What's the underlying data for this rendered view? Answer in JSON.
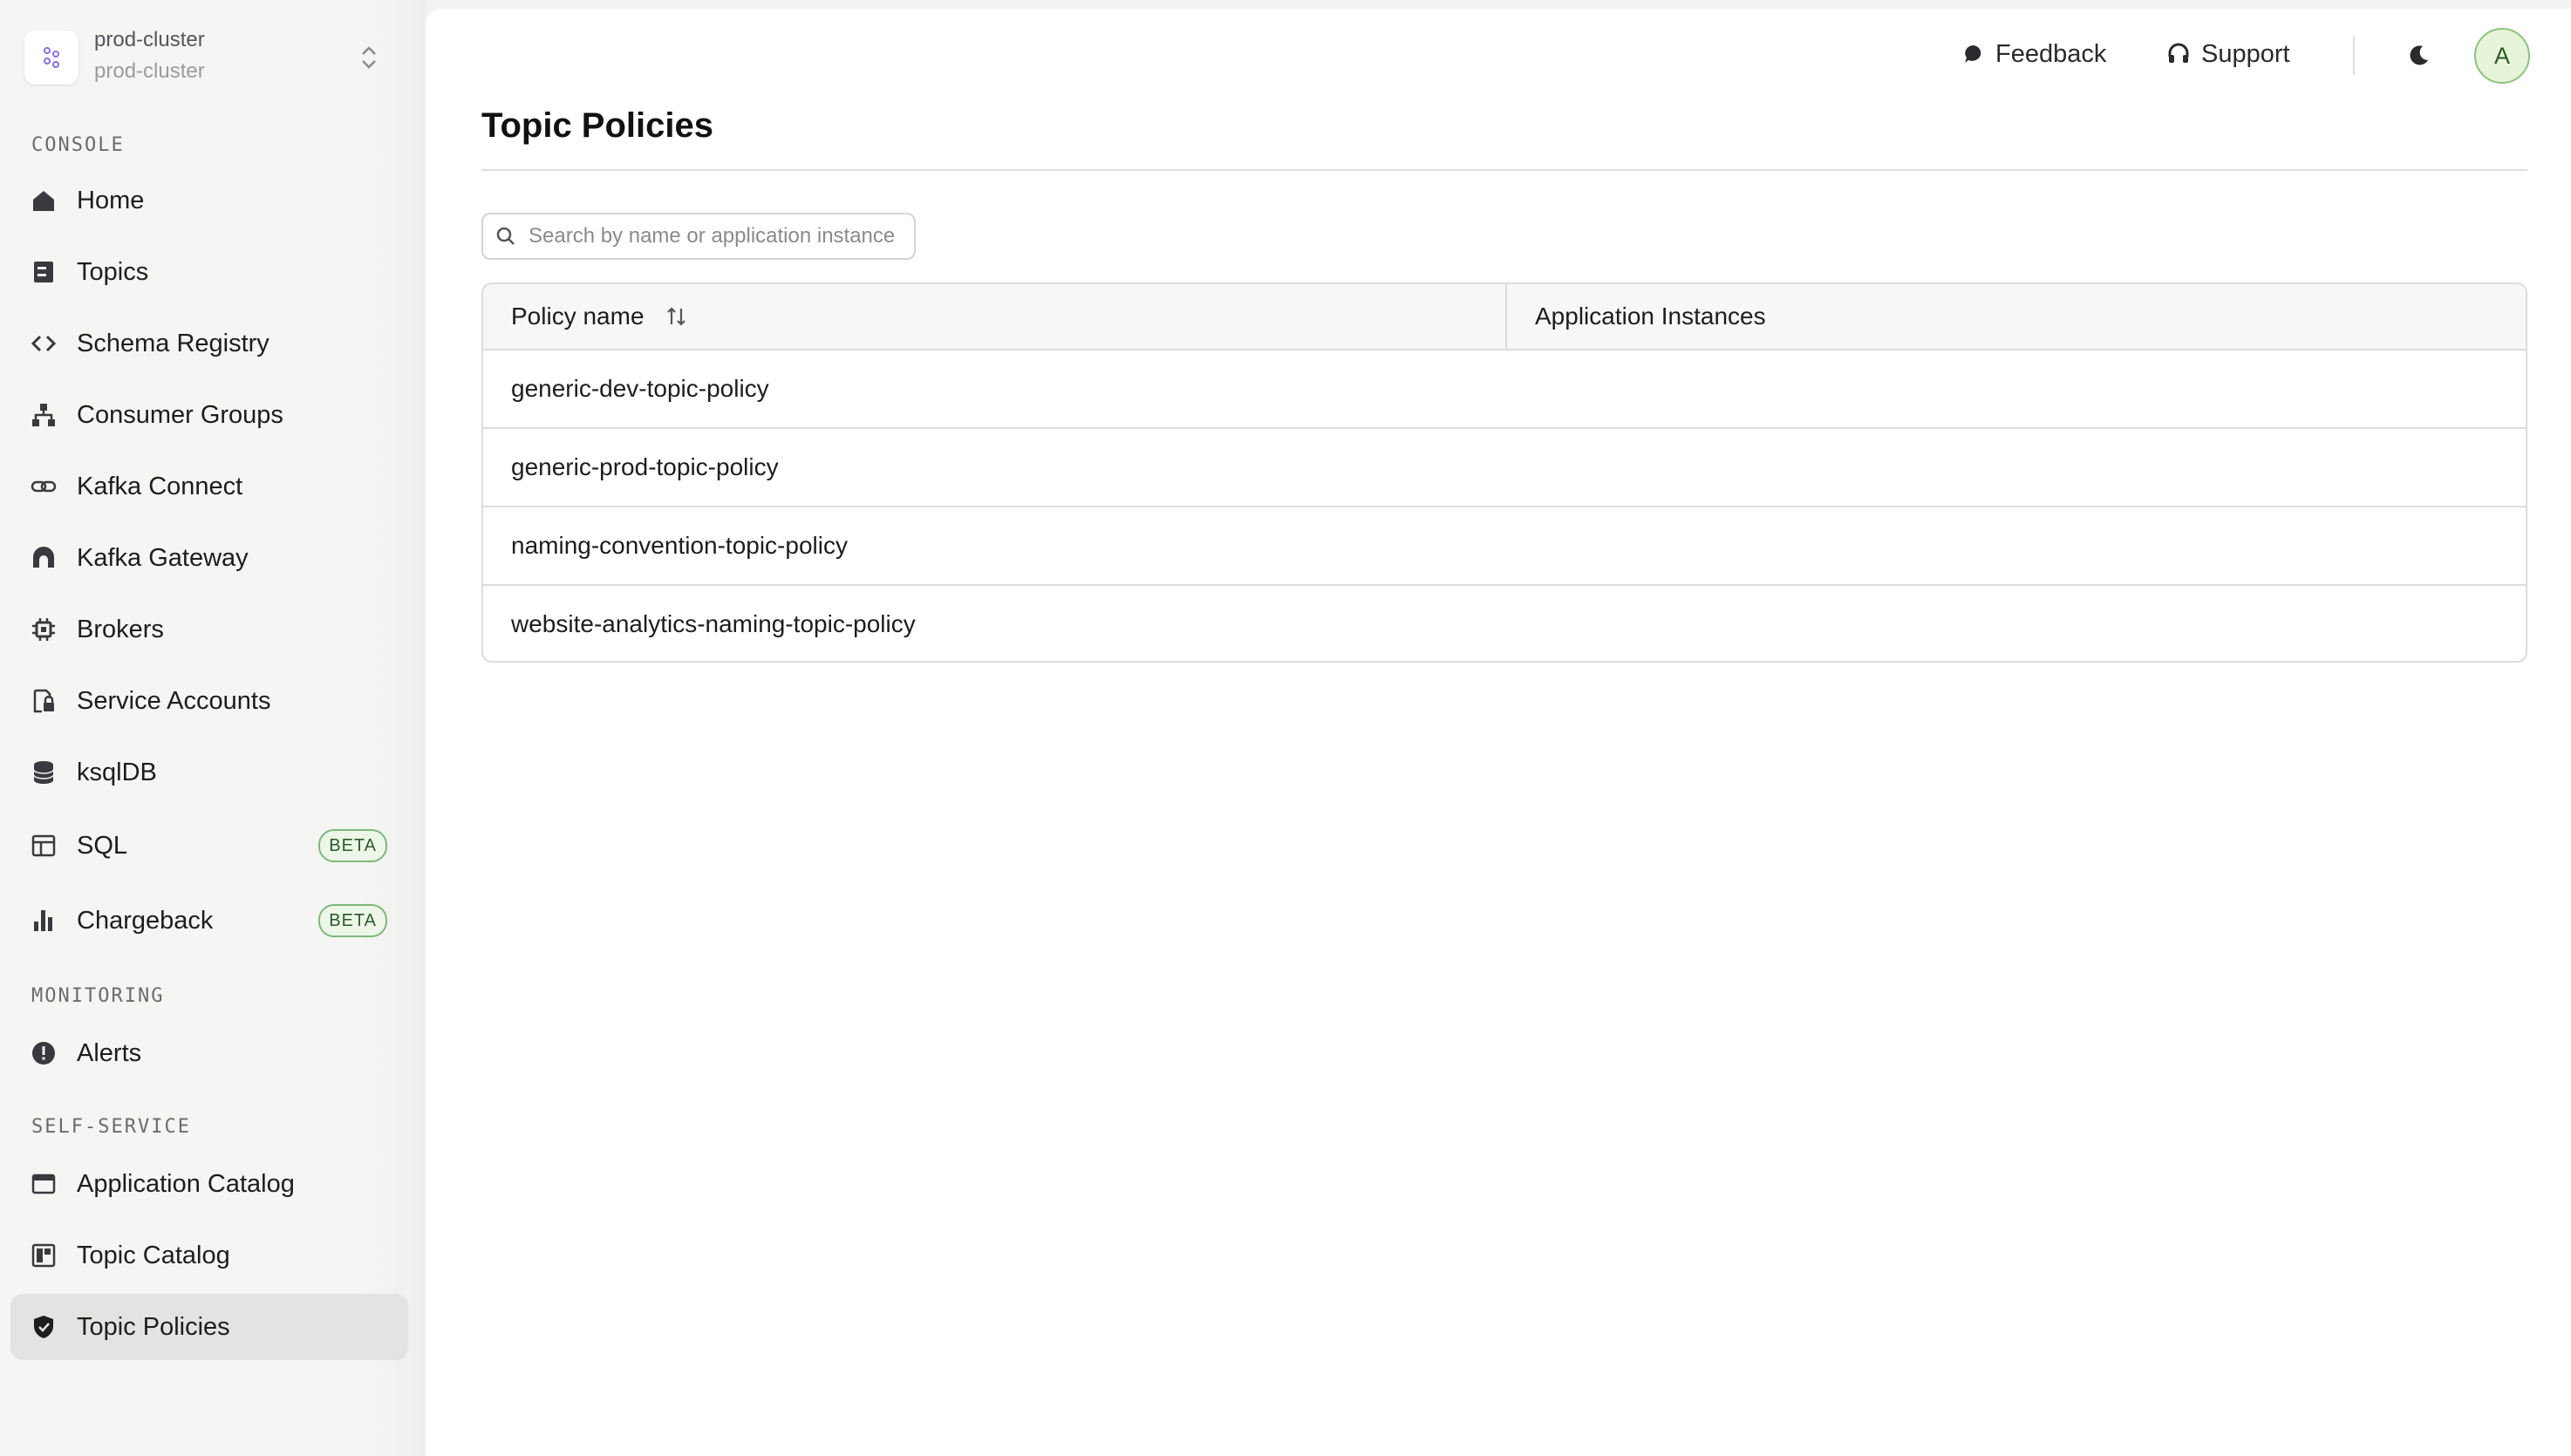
{
  "cluster": {
    "name": "prod-cluster",
    "subtitle": "prod-cluster"
  },
  "sidebar": {
    "sections": {
      "console": "CONSOLE",
      "monitoring": "MONITORING",
      "self_service": "SELF-SERVICE"
    },
    "items": [
      {
        "label": "Home",
        "icon": "home-icon"
      },
      {
        "label": "Topics",
        "icon": "topics-icon"
      },
      {
        "label": "Schema Registry",
        "icon": "code-icon"
      },
      {
        "label": "Consumer Groups",
        "icon": "hierarchy-icon"
      },
      {
        "label": "Kafka Connect",
        "icon": "link-icon"
      },
      {
        "label": "Kafka Gateway",
        "icon": "gateway-icon"
      },
      {
        "label": "Brokers",
        "icon": "chip-icon"
      },
      {
        "label": "Service Accounts",
        "icon": "lock-file-icon"
      },
      {
        "label": "ksqlDB",
        "icon": "database-icon"
      },
      {
        "label": "SQL",
        "icon": "table-icon",
        "badge": "BETA"
      },
      {
        "label": "Chargeback",
        "icon": "bar-chart-icon",
        "badge": "BETA"
      },
      {
        "label": "Alerts",
        "icon": "alert-icon"
      },
      {
        "label": "Application Catalog",
        "icon": "window-icon"
      },
      {
        "label": "Topic Catalog",
        "icon": "catalog-icon"
      },
      {
        "label": "Topic Policies",
        "icon": "shield-icon",
        "active": true
      }
    ]
  },
  "header": {
    "feedback": "Feedback",
    "support": "Support",
    "avatar_initial": "A"
  },
  "page": {
    "title": "Topic Policies",
    "search_placeholder": "Search by name or application instance"
  },
  "table": {
    "columns": [
      "Policy name",
      "Application Instances"
    ],
    "rows": [
      {
        "policy_name": "generic-dev-topic-policy",
        "application_instances": ""
      },
      {
        "policy_name": "generic-prod-topic-policy",
        "application_instances": ""
      },
      {
        "policy_name": "naming-convention-topic-policy",
        "application_instances": ""
      },
      {
        "policy_name": "website-analytics-naming-topic-policy",
        "application_instances": ""
      }
    ]
  },
  "colors": {
    "active_nav_bg": "#e3e3e1",
    "badge_border": "#7fb87a",
    "avatar_bg": "#e6f4d9"
  }
}
